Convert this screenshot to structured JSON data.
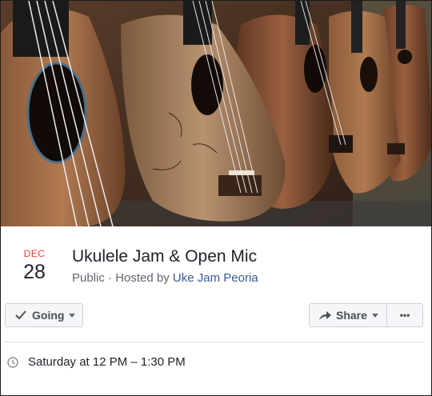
{
  "event": {
    "month": "DEC",
    "day": "28",
    "title": "Ukulele Jam & Open Mic",
    "privacy": "Public",
    "separator": " · ",
    "hosted_by_prefix": "Hosted by ",
    "host_name": "Uke Jam Peoria",
    "time": "Saturday at 12 PM – 1:30 PM"
  },
  "actions": {
    "going_label": "Going",
    "share_label": "Share",
    "more_label": "•••"
  },
  "icons": {
    "going": "checkmark-icon",
    "share": "share-arrow-icon",
    "time": "clock-icon"
  },
  "colors": {
    "month_red": "#e8403a",
    "link_blue": "#385898",
    "button_bg": "#f5f6f7"
  }
}
